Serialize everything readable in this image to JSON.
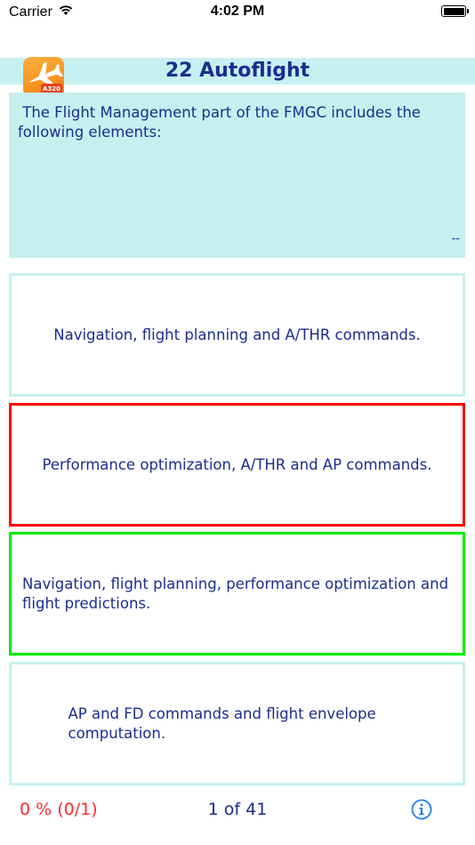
{
  "status_bar": {
    "carrier": "Carrier",
    "time": "4:02 PM"
  },
  "header": {
    "title": "22 Autoflight",
    "logo_badge": "A320"
  },
  "question": {
    "text": " The Flight Management part of the FMGC includes the following elements:",
    "meta": "--"
  },
  "answers": [
    {
      "text": "Navigation, flight planning and A/THR commands.",
      "state": "neutral"
    },
    {
      "text": "Performance optimization, A/THR and AP commands.",
      "state": "wrong"
    },
    {
      "text": "Navigation, flight planning, performance optimization and flight predictions.",
      "state": "correct"
    },
    {
      "text": "AP and FD commands and flight envelope computation.",
      "state": "neutral"
    }
  ],
  "footer": {
    "score": "0 % (0/1)",
    "page_counter": "1 of 41",
    "info_icon": "info-circle-icon"
  },
  "colors": {
    "accent_blue": "#1a2d8e",
    "header_bg": "#c6f0f0",
    "wrong": "#ff0000",
    "correct": "#00ee00",
    "score": "#ff2a2a",
    "info_blue": "#1e7cf2"
  }
}
